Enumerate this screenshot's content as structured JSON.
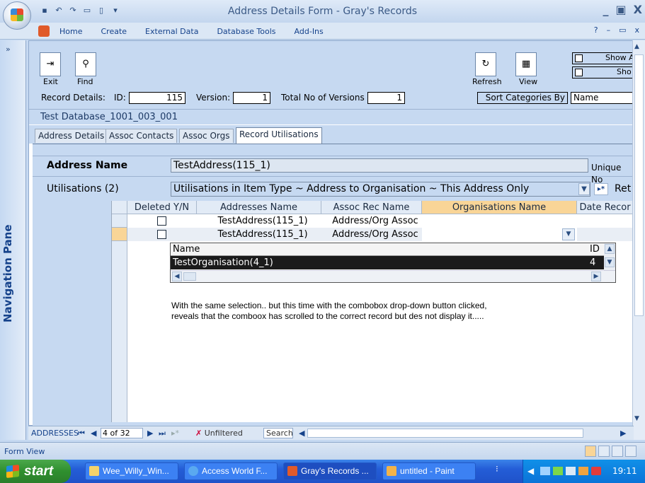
{
  "window": {
    "title": "Address Details Form - Gray's Records",
    "controls": [
      "_",
      "▣",
      "X"
    ]
  },
  "qat_icons": [
    "save-icon",
    "undo-icon",
    "redo-icon",
    "print-preview-icon",
    "new-icon"
  ],
  "ribbon": {
    "tabs": [
      "Home",
      "Create",
      "External Data",
      "Database Tools",
      "Add-Ins"
    ],
    "help": "?",
    "minimize": "–",
    "restore": "▭",
    "close": "x"
  },
  "nav_pane": {
    "label": "Navigation Pane",
    "toggle": "»"
  },
  "toolbar": {
    "exit_label": "Exit",
    "find_label": "Find",
    "refresh_label": "Refresh",
    "view_label": "View",
    "show_all_label": "Show A",
    "show_label": "Sho"
  },
  "record_details": {
    "label": "Record Details:",
    "id_label": "ID:",
    "id_value": "115",
    "version_label": "Version:",
    "version_value": "1",
    "total_label": "Total No of Versions",
    "total_value": "1",
    "sort_label": "Sort Categories By",
    "sort_value": "Name"
  },
  "database_name": "Test Database_1001_003_001",
  "form_tabs": [
    "Address Details",
    "Assoc Contacts",
    "Assoc Orgs",
    "Record Utilisations"
  ],
  "active_tab": "Record Utilisations",
  "address_name": {
    "label": "Address Name",
    "value": "TestAddress(115_1)",
    "unique_label": "Unique No"
  },
  "utilisations": {
    "label": "Utilisations (2)",
    "value": "Utilisations in Item Type ~ Address to Organisation ~ This Address Only",
    "ret_label": "Ret"
  },
  "datasheet": {
    "columns": [
      "Deleted Y/N",
      "Addresses Name",
      "Assoc Rec Name",
      "Organisations Name",
      "Date Recor"
    ],
    "rows": [
      {
        "deleted": "",
        "address": "TestAddress(115_1)",
        "assoc": "Address/Org Assoc",
        "org": ""
      },
      {
        "deleted": "",
        "address": "TestAddress(115_1)",
        "assoc": "Address/Org Assoc",
        "org": ""
      }
    ]
  },
  "combo_dropdown": {
    "col_name": "Name",
    "col_id": "ID",
    "row_name": "TestOrganisation(4_1)",
    "row_id": "4"
  },
  "note": "With the same selection.. but this time with the combobox drop-down button clicked, reveals that the comboox has scrolled to the correct record but des not display it.....",
  "record_nav": {
    "label": "ADDRESSES",
    "position": "4 of 32",
    "filter": "Unfiltered",
    "search": "Search"
  },
  "status": {
    "text": "Form View"
  },
  "taskbar": {
    "start": "start",
    "items": [
      "Wee_Willy_Win...",
      "Access World F...",
      "Gray's Records ...",
      "untitled - Paint"
    ],
    "active_item": "Gray's Records ...",
    "clock": "19:11"
  }
}
